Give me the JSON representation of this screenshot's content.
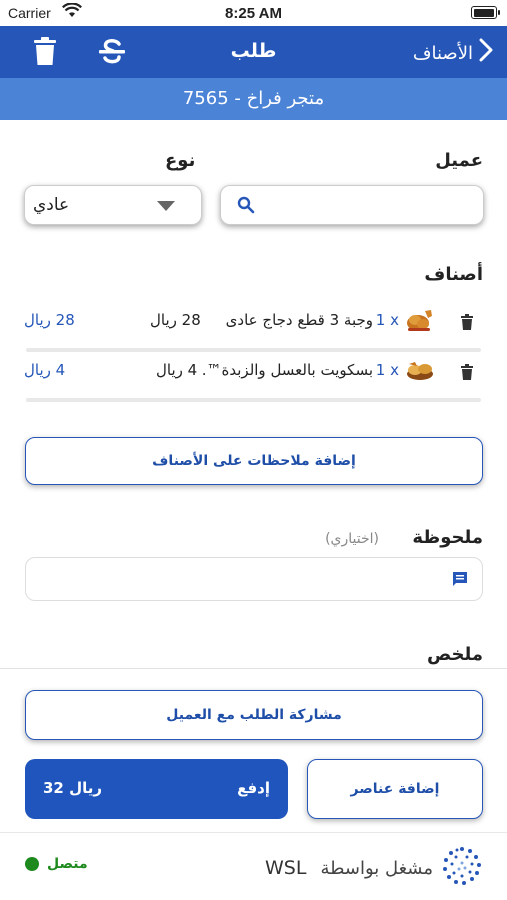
{
  "status_bar": {
    "carrier": "Carrier",
    "time": "8:25 AM"
  },
  "nav": {
    "title": "طلب",
    "back_label": "الأصناف"
  },
  "store": {
    "label": "7565 - متجر فراخ"
  },
  "form": {
    "customer_label": "عميل",
    "type_label": "نوع",
    "type_value": "عادي",
    "customer_placeholder": ""
  },
  "items": {
    "label": "أصناف",
    "rows": [
      {
        "qty": "1 x",
        "name": "وجبة 3 قطع دجاج عادى",
        "unit_price": "28 ريال",
        "total": "28 ريال"
      },
      {
        "qty": "1 x",
        "name": "بسكويت بالعسل والزبدة™...",
        "unit_price": "4 ريال",
        "total": "4 ريال"
      }
    ]
  },
  "add_notes_button": "إضافة ملاحظات على الأصناف",
  "note": {
    "label": "ملحوظة",
    "optional": "(اختياري)",
    "placeholder": ""
  },
  "summary": {
    "label": "ملخص"
  },
  "share_button": "مشاركة الطلب مع العميل",
  "add_items_button": "إضافة عناصر",
  "pay": {
    "label": "إدفع",
    "amount": "32 ريال"
  },
  "footer": {
    "status": "متصل",
    "powered_by": "مشغل بواسطة",
    "brand": "WSL"
  },
  "colors": {
    "primary": "#2556b8",
    "secondary": "#4b83d6",
    "online": "#1e8a1e"
  },
  "icons": [
    "trash-icon",
    "strikethrough-icon",
    "chevron-right-icon",
    "search-icon",
    "caret-down-icon",
    "food-icon",
    "comment-icon",
    "brand-logo-icon"
  ]
}
